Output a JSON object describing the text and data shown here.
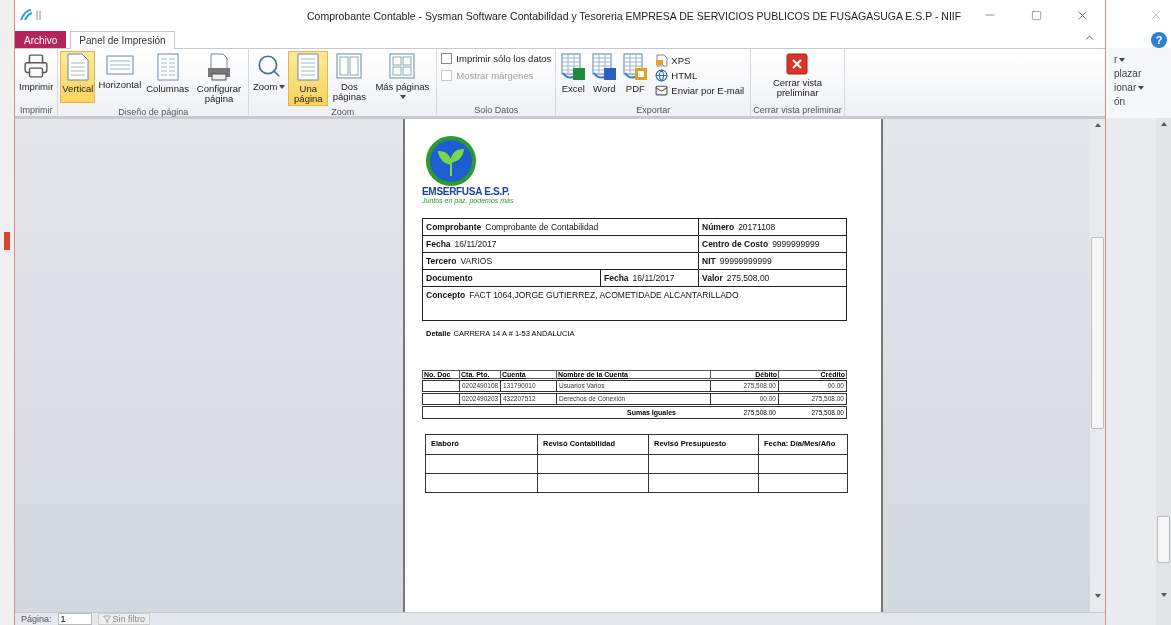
{
  "window": {
    "title": "Comprobante Contable  -  Sysman Software Contabilidad y Tesoreria EMPRESA DE SERVICIOS PUBLICOS DE FUSAGASUGA E.S.P - NIIF"
  },
  "tabs": [
    {
      "label": "Archivo",
      "kind": "file",
      "selected": false
    },
    {
      "label": "Panel de Impresión",
      "kind": "tab",
      "selected": true
    }
  ],
  "ribbon": {
    "groups": [
      {
        "label": "Imprimir",
        "items": [
          {
            "kind": "large",
            "label": "Imprimir",
            "selected": false
          }
        ]
      },
      {
        "label": "Diseño de página",
        "items": [
          {
            "kind": "large",
            "label": "Vertical",
            "selected": true
          },
          {
            "kind": "large",
            "label": "Horizontal",
            "selected": false
          },
          {
            "kind": "large",
            "label": "Columnas",
            "selected": false
          },
          {
            "kind": "large",
            "label": "Configurar página",
            "selected": false
          }
        ]
      },
      {
        "label": "Zoom",
        "items": [
          {
            "kind": "large",
            "label": "Zoom",
            "selected": false,
            "dropdown": true
          },
          {
            "kind": "large",
            "label": "Una página",
            "selected": true
          },
          {
            "kind": "large",
            "label": "Dos páginas",
            "selected": false
          },
          {
            "kind": "large",
            "label": "Más páginas",
            "selected": false,
            "dropdown": true
          }
        ]
      },
      {
        "label": "Solo Datos",
        "items": [
          {
            "kind": "checkbox",
            "label": "Imprimir sólo los datos",
            "checked": false,
            "disabled": false
          },
          {
            "kind": "checkbox",
            "label": "Mostrar márgenes",
            "checked": false,
            "disabled": true
          }
        ]
      },
      {
        "label": "Exportar",
        "items": [
          {
            "kind": "large",
            "label": "Excel",
            "selected": false
          },
          {
            "kind": "large",
            "label": "Word",
            "selected": false
          },
          {
            "kind": "large",
            "label": "PDF",
            "selected": false
          },
          {
            "kind": "small",
            "label": "XPS"
          },
          {
            "kind": "small",
            "label": "HTML"
          },
          {
            "kind": "small",
            "label": "Enviar por E-mail"
          }
        ]
      },
      {
        "label": "Cerrar vista preliminar",
        "items": [
          {
            "kind": "large",
            "label": "Cerrar vista preliminar",
            "selected": false
          }
        ]
      }
    ]
  },
  "document": {
    "logo": {
      "name": "EMSERFUSA E.S.P.",
      "slogan": "Juntos en paz, podemos más"
    },
    "header_rows": [
      [
        {
          "label": "Comprobante",
          "value": "Comprobante de Contabilidad"
        },
        {
          "label": "Número",
          "value": "20171108"
        }
      ],
      [
        {
          "label": "Fecha",
          "value": "16/11/2017"
        },
        {
          "label": "Centro de Costo",
          "value": "9999999999"
        }
      ],
      [
        {
          "label": "Tercero",
          "value": "VARIOS"
        },
        {
          "label": "NIT",
          "value": "99999999999"
        }
      ],
      [
        {
          "label": "Documento"
        },
        {
          "label": "Fecha",
          "value": "16/11/2017"
        },
        {
          "label": "Valor",
          "value": "275,508.00"
        }
      ],
      [
        {
          "label": "Concepto",
          "value": "FACT 1064,JORGE GUTIERREZ, ACOMETIDADE ALCANTARILLADO"
        }
      ]
    ],
    "detail": {
      "label": "Detalle",
      "value": "CARRERA 14 A # 1-53 ANDALUCIA"
    },
    "accounts": {
      "columns": [
        "No. Doc",
        "Cta. Pto.",
        "Cuenta",
        "Nombre de la Cuenta",
        "Débito",
        "Crédito"
      ],
      "rows": [
        [
          null,
          "0202490108",
          "131790010",
          "Usuarios Varios",
          "275,508.00",
          "00.00"
        ],
        [
          null,
          "0202490203",
          "432207512",
          "Derechos de Conexión",
          "00.00",
          "275,508.00"
        ]
      ],
      "total": {
        "label": "Sumas Iguales",
        "debit": "275,508.00",
        "credit": "275,508.00"
      }
    },
    "signatures": {
      "columns": [
        "Elaboró",
        "Revisó Contabilidad",
        "Revisó Presupuesto",
        "Fecha: Día/Mes/Año"
      ]
    }
  },
  "status_bar": {
    "page_label": "Página:",
    "page": "1",
    "filter": "Sin filtro"
  },
  "background_window": {
    "help_label": "?",
    "items": [
      {
        "text": "r",
        "dropdown": true
      },
      {
        "text": "plazar",
        "dropdown": false
      },
      {
        "text": "ionar",
        "dropdown": true
      },
      {
        "text": "ón",
        "dropdown": false
      }
    ]
  }
}
